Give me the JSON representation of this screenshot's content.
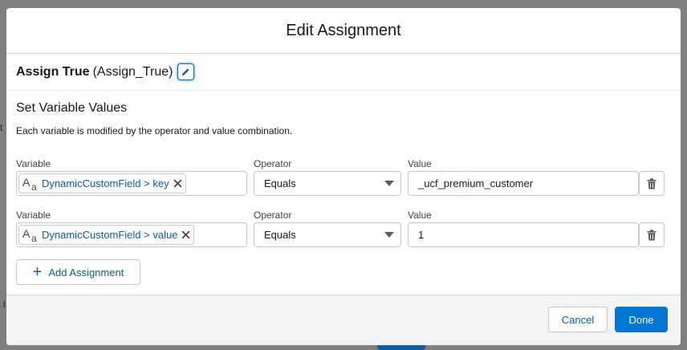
{
  "modal": {
    "title": "Edit Assignment"
  },
  "element": {
    "label": "Assign True",
    "api_name": "(Assign_True)"
  },
  "section": {
    "title": "Set Variable Values",
    "description": "Each variable is modified by the operator and value combination."
  },
  "rows": [
    {
      "variable_label": "Variable",
      "operator_label": "Operator",
      "value_label": "Value",
      "variable": "DynamicCustomField > key",
      "operator": "Equals",
      "value": "_ucf_premium_customer"
    },
    {
      "variable_label": "Variable",
      "operator_label": "Operator",
      "value_label": "Value",
      "variable": "DynamicCustomField > value",
      "operator": "Equals",
      "value": "1"
    }
  ],
  "add_assignment_label": "Add Assignment",
  "footer": {
    "cancel_label": "Cancel",
    "done_label": "Done"
  },
  "background": {
    "fragment_1": "t",
    "fragment_2": "l"
  },
  "icons": {
    "edit": "pencil-icon",
    "variable_type": "text-type-icon",
    "remove": "close-icon",
    "delete": "trash-icon",
    "add": "plus-icon"
  },
  "colors": {
    "brand": "#0176d3",
    "link": "#0b5cab"
  }
}
